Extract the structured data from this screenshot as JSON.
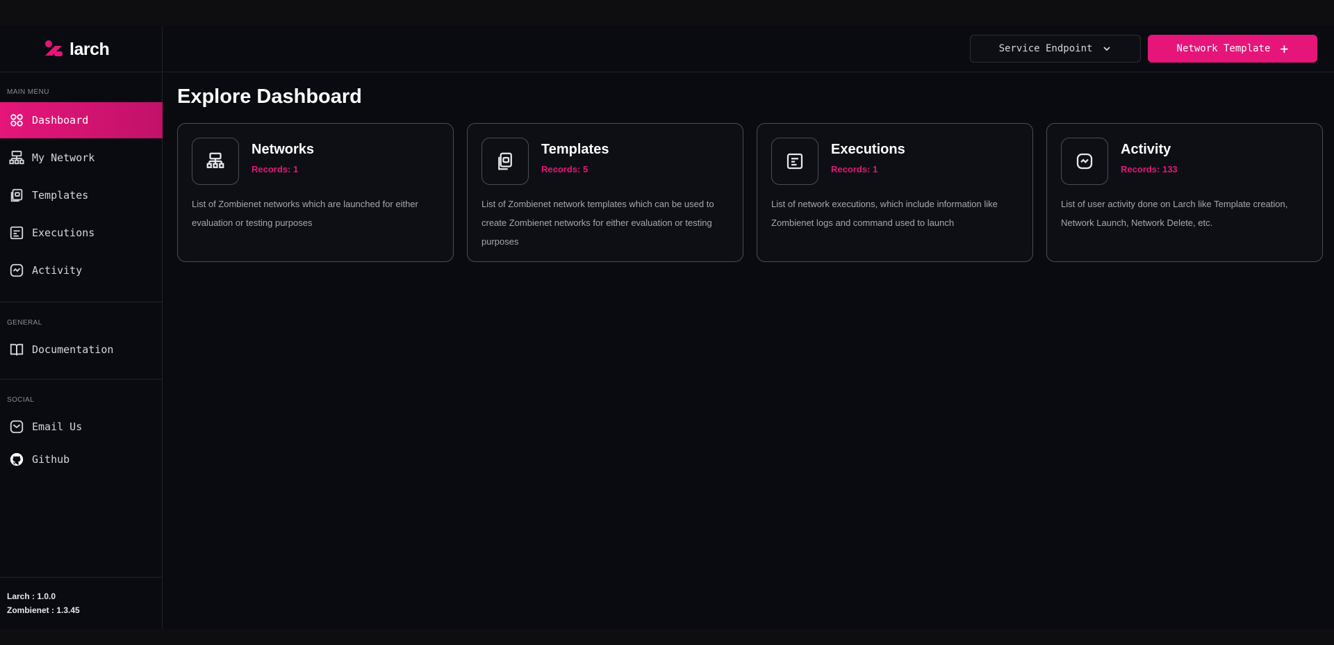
{
  "app": {
    "name": "larch"
  },
  "sidebar": {
    "sections": {
      "main_menu": "MAIN MENU",
      "general": "GENERAL",
      "social": "SOCIAL"
    },
    "items": [
      {
        "label": "Dashboard",
        "icon": "grid-icon",
        "active": true
      },
      {
        "label": "My Network",
        "icon": "network-icon",
        "active": false
      },
      {
        "label": "Templates",
        "icon": "template-icon",
        "active": false
      },
      {
        "label": "Executions",
        "icon": "terminal-icon",
        "active": false
      },
      {
        "label": "Activity",
        "icon": "activity-icon",
        "active": false
      }
    ],
    "general_items": [
      {
        "label": "Documentation",
        "icon": "book-icon"
      }
    ],
    "social_items": [
      {
        "label": "Email Us",
        "icon": "mail-icon"
      },
      {
        "label": "Github",
        "icon": "github-icon"
      }
    ],
    "versions": {
      "larch": "Larch : 1.0.0",
      "zombienet": "Zombienet : 1.3.45"
    }
  },
  "header": {
    "endpoint_label": "Service Endpoint",
    "primary_button_label": "Network Template",
    "primary_button_plus": "+"
  },
  "main": {
    "title": "Explore Dashboard",
    "cards": [
      {
        "title": "Networks",
        "records": "Records: 1",
        "description": "List of Zombienet networks which are launched for either evaluation or testing purposes",
        "icon": "network-icon"
      },
      {
        "title": "Templates",
        "records": "Records: 5",
        "description": "List of Zombienet network templates which can be used to create Zombienet networks for either evaluation or testing purposes",
        "icon": "template-icon"
      },
      {
        "title": "Executions",
        "records": "Records: 1",
        "description": "List of network executions, which include information like Zombienet logs and command used to launch",
        "icon": "terminal-icon"
      },
      {
        "title": "Activity",
        "records": "Records: 133",
        "description": "List of user activity done on Larch like Template creation, Network Launch, Network Delete, etc.",
        "icon": "activity-icon"
      }
    ]
  },
  "colors": {
    "accent": "#e6157a",
    "background": "#090b10",
    "card_border": "#4a4d55"
  }
}
